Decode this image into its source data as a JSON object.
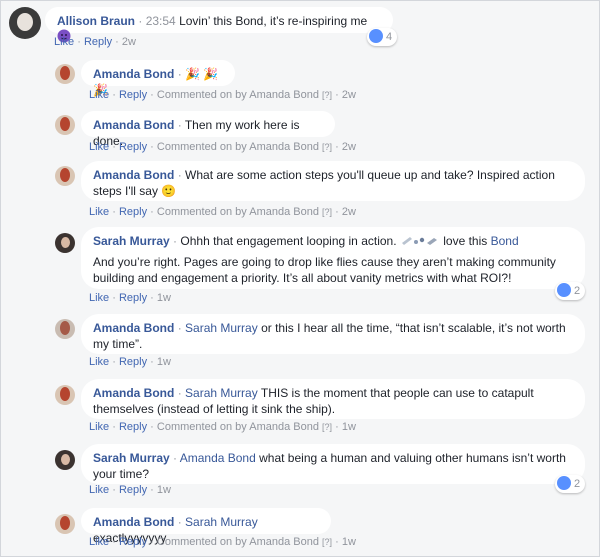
{
  "separator": "·",
  "actions": {
    "like": "Like",
    "reply": "Reply",
    "commented_on_by": "Commented on by"
  },
  "help_marker": "[?]",
  "comments": [
    {
      "author": "Allison Braun",
      "time_prefix": "23:54",
      "text": "Lovin’ this Bond, it’s re-inspiring me",
      "emoji": "purple-face-emoji",
      "age": "2w",
      "reaction_count": "4"
    },
    {
      "author": "Amanda Bond",
      "text": "🎉 🎉🎉",
      "commented_on_by": "Amanda Bond",
      "age": "2w"
    },
    {
      "author": "Amanda Bond",
      "text": "Then my work here is done.",
      "commented_on_by": "Amanda Bond",
      "age": "2w"
    },
    {
      "author": "Amanda Bond",
      "text_line1": "What are some action steps you'll queue up and take? Inspired action",
      "text_line2": "steps I'll say 🙂",
      "commented_on_by": "Amanda Bond",
      "age": "2w"
    },
    {
      "author": "Sarah Murray",
      "text_a": "Ohhh that engagement looping in action.",
      "text_b": "love this",
      "mention": "Bond",
      "para2_line1": "And you’re right. Pages are going to drop like flies cause they aren’t making community",
      "para2_line2": "building and engagement a priority. It’s all about vanity metrics with what ROI?!",
      "age": "1w",
      "reaction_count": "2"
    },
    {
      "author": "Amanda Bond",
      "mention": "Sarah Murray",
      "text_line1": "or this I hear all the time, “that isn’t scalable, it’s not worth",
      "text_line2": "my time”.",
      "age": "1w"
    },
    {
      "author": "Amanda Bond",
      "mention": "Sarah Murray",
      "text_line1": "THIS is the moment that people can use to catapult",
      "text_line2": "themselves (instead of letting it sink the ship).",
      "commented_on_by": "Amanda Bond",
      "age": "1w"
    },
    {
      "author": "Sarah Murray",
      "mention": "Amanda Bond",
      "text_line1": "what being a human and valuing other humans isn’t worth",
      "text_line2": "your time?",
      "age": "1w",
      "reaction_count": "2"
    },
    {
      "author": "Amanda Bond",
      "mention": "Sarah Murray",
      "text": "exactlyyyyyyy",
      "commented_on_by": "Amanda Bond",
      "age": "1w"
    }
  ],
  "colors": {
    "link": "#385898",
    "like_blue": "#5890ff",
    "bubble": "#ffffff",
    "background": "#f5f6f7"
  }
}
